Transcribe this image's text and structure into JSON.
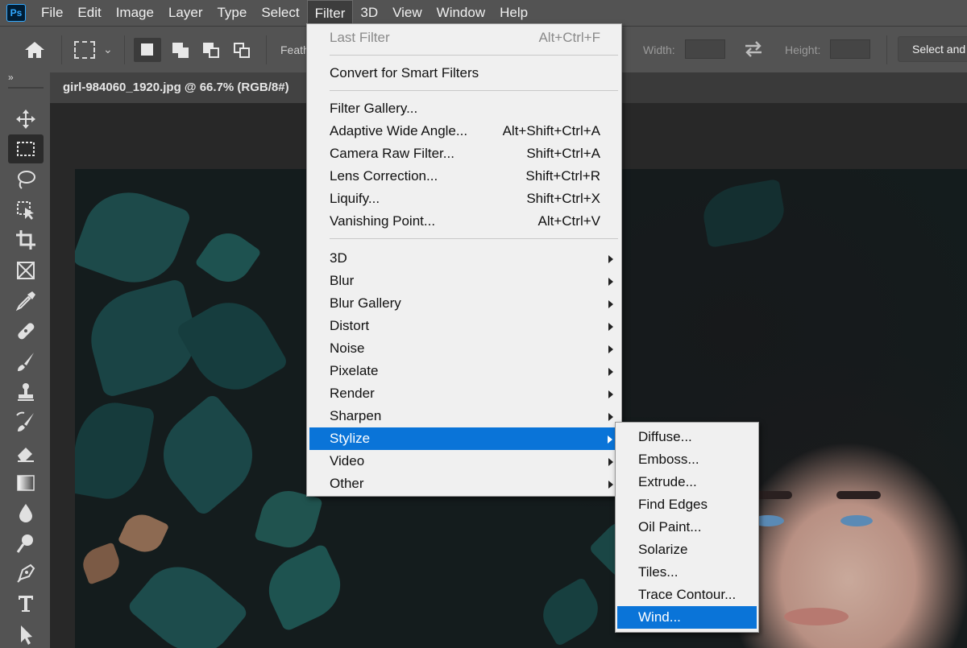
{
  "menubar": {
    "logo": "Ps",
    "items": [
      "File",
      "Edit",
      "Image",
      "Layer",
      "Type",
      "Select",
      "Filter",
      "3D",
      "View",
      "Window",
      "Help"
    ],
    "active": "Filter"
  },
  "options": {
    "feather_label": "Feath",
    "width_label": "Width:",
    "height_label": "Height:",
    "select_button": "Select and"
  },
  "tools_header": "»",
  "document": {
    "tab_title": "girl-984060_1920.jpg @ 66.7% (RGB/8#)"
  },
  "filter_menu": {
    "items": [
      {
        "label": "Last Filter",
        "shortcut": "Alt+Ctrl+F",
        "disabled": true
      },
      {
        "label": "Convert for Smart Filters",
        "shortcut": ""
      },
      {
        "label": "Filter Gallery...",
        "shortcut": ""
      },
      {
        "label": "Adaptive Wide Angle...",
        "shortcut": "Alt+Shift+Ctrl+A"
      },
      {
        "label": "Camera Raw Filter...",
        "shortcut": "Shift+Ctrl+A"
      },
      {
        "label": "Lens Correction...",
        "shortcut": "Shift+Ctrl+R"
      },
      {
        "label": "Liquify...",
        "shortcut": "Shift+Ctrl+X"
      },
      {
        "label": "Vanishing Point...",
        "shortcut": "Alt+Ctrl+V"
      },
      {
        "label": "3D",
        "submenu": true
      },
      {
        "label": "Blur",
        "submenu": true
      },
      {
        "label": "Blur Gallery",
        "submenu": true
      },
      {
        "label": "Distort",
        "submenu": true
      },
      {
        "label": "Noise",
        "submenu": true
      },
      {
        "label": "Pixelate",
        "submenu": true
      },
      {
        "label": "Render",
        "submenu": true
      },
      {
        "label": "Sharpen",
        "submenu": true
      },
      {
        "label": "Stylize",
        "submenu": true,
        "highlighted": true
      },
      {
        "label": "Video",
        "submenu": true
      },
      {
        "label": "Other",
        "submenu": true
      }
    ]
  },
  "stylize_submenu": {
    "items": [
      "Diffuse...",
      "Emboss...",
      "Extrude...",
      "Find Edges",
      "Oil Paint...",
      "Solarize",
      "Tiles...",
      "Trace Contour...",
      "Wind..."
    ],
    "highlighted": "Wind..."
  },
  "colors": {
    "highlight": "#0a74d8",
    "menu_bg": "#f0f0f0",
    "chrome": "#535353"
  }
}
